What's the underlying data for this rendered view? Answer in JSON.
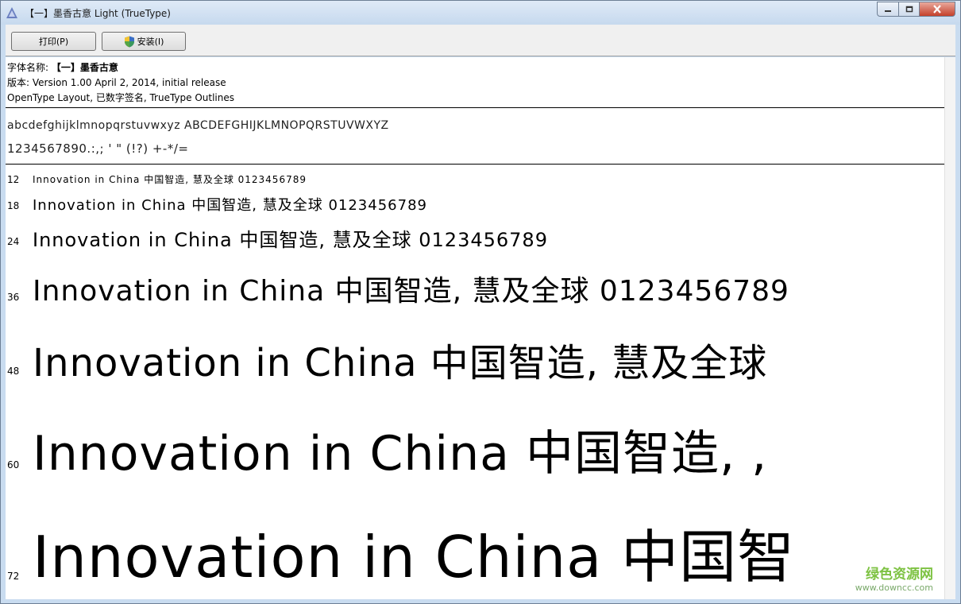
{
  "window": {
    "title": "【一】墨香古意 Light (TrueType)",
    "icons": {
      "app": "font-viewer-icon"
    }
  },
  "caption_buttons": {
    "minimize_icon": "minimize-icon",
    "maximize_icon": "maximize-icon",
    "close_icon": "close-icon"
  },
  "toolbar": {
    "print_label": "打印(P)",
    "install_label": "安装(I)",
    "install_icon": "uac-shield-icon"
  },
  "info": {
    "name_label": "字体名称:",
    "name_value": "【一】墨香古意",
    "version": "版本: Version 1.00 April 2, 2014, initial release",
    "layout": "OpenType Layout, 已数字签名, TrueType Outlines"
  },
  "charset": {
    "line1": "abcdefghijklmnopqrstuvwxyz ABCDEFGHIJKLMNOPQRSTUVWXYZ",
    "line2": "1234567890.:,; ' \" (!?) +-*/="
  },
  "samples": [
    {
      "size": "12",
      "text": "Innovation in China 中国智造, 慧及全球 0123456789"
    },
    {
      "size": "18",
      "text": "Innovation in China 中国智造, 慧及全球 0123456789"
    },
    {
      "size": "24",
      "text": "Innovation in China 中国智造, 慧及全球 0123456789"
    },
    {
      "size": "36",
      "text": "Innovation in China 中国智造, 慧及全球 0123456789"
    },
    {
      "size": "48",
      "text": "Innovation in China 中国智造, 慧及全球"
    },
    {
      "size": "60",
      "text": "Innovation in China 中国智造, ,"
    },
    {
      "size": "72",
      "text": "Innovation in China 中国智"
    }
  ],
  "watermark": {
    "title": "绿色资源网",
    "url": "www.downcc.com"
  }
}
